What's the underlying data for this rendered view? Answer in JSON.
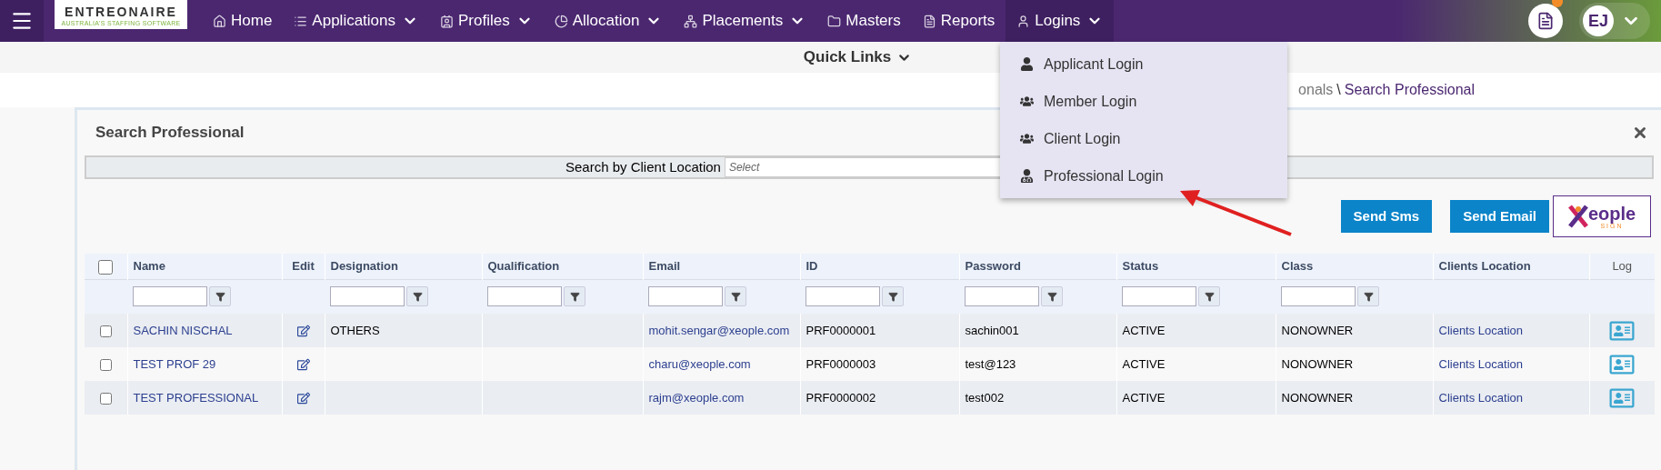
{
  "nav": {
    "logo": {
      "name": "ENTREONAIRE",
      "tagline": "AUSTRALIA'S STAFFING SOFTWARE"
    },
    "items": [
      {
        "label": "Home",
        "kind": "home",
        "caret": false,
        "selected": false
      },
      {
        "label": "Applications",
        "kind": "list",
        "caret": true,
        "selected": false
      },
      {
        "label": "Profiles",
        "kind": "profile",
        "caret": true,
        "selected": false
      },
      {
        "label": "Allocation",
        "kind": "pie",
        "caret": true,
        "selected": false
      },
      {
        "label": "Placements",
        "kind": "nodes",
        "caret": true,
        "selected": false
      },
      {
        "label": "Masters",
        "kind": "folder",
        "caret": false,
        "selected": false
      },
      {
        "label": "Reports",
        "kind": "report",
        "caret": false,
        "selected": false
      },
      {
        "label": "Logins",
        "kind": "user",
        "caret": true,
        "selected": true
      }
    ],
    "avatar": "EJ"
  },
  "quick_links": "Quick Links",
  "dropdown": [
    {
      "label": "Applicant Login",
      "kind": "user"
    },
    {
      "label": "Member Login",
      "kind": "users"
    },
    {
      "label": "Client Login",
      "kind": "users"
    },
    {
      "label": "Professional Login",
      "kind": "professional"
    }
  ],
  "breadcrumb": [
    "onals",
    "Search Professional"
  ],
  "breadcrumb_separator": "\\",
  "panel": {
    "title": "Search Professional",
    "search_label": "Search by Client Location",
    "search_placeholder": "Select",
    "buttons": [
      "Send Sms",
      "Send Email"
    ],
    "sign_logo": {
      "name": "eople",
      "sub": "SIGN"
    }
  },
  "table": {
    "all_checked": false,
    "columns": [
      {
        "label": "Name",
        "filter": true
      },
      {
        "label": "Edit",
        "filter": false
      },
      {
        "label": "Designation",
        "filter": true
      },
      {
        "label": "Qualification",
        "filter": true
      },
      {
        "label": "Email",
        "filter": true
      },
      {
        "label": "ID",
        "filter": true
      },
      {
        "label": "Password",
        "filter": true
      },
      {
        "label": "Status",
        "filter": true
      },
      {
        "label": "Class",
        "filter": true
      },
      {
        "label": "Clients Location",
        "filter": false
      },
      {
        "label": "Log",
        "filter": false
      }
    ],
    "rows": [
      {
        "checked": false,
        "name": "SACHIN NISCHAL",
        "designation": "OTHERS",
        "qualification": "",
        "email": "mohit.sengar@xeople.com",
        "id": "PRF0000001",
        "password": "sachin001",
        "status": "ACTIVE",
        "class": "NONOWNER",
        "location": "Clients Location"
      },
      {
        "checked": false,
        "name": "TEST PROF 29",
        "designation": "",
        "qualification": "",
        "email": "charu@xeople.com",
        "id": "PRF0000003",
        "password": "test@123",
        "status": "ACTIVE",
        "class": "NONOWNER",
        "location": "Clients Location"
      },
      {
        "checked": false,
        "name": "TEST PROFESSIONAL",
        "designation": "",
        "qualification": "",
        "email": "rajm@xeople.com",
        "id": "PRF0000002",
        "password": "test002",
        "status": "ACTIVE",
        "class": "NONOWNER",
        "location": "Clients Location"
      }
    ]
  }
}
